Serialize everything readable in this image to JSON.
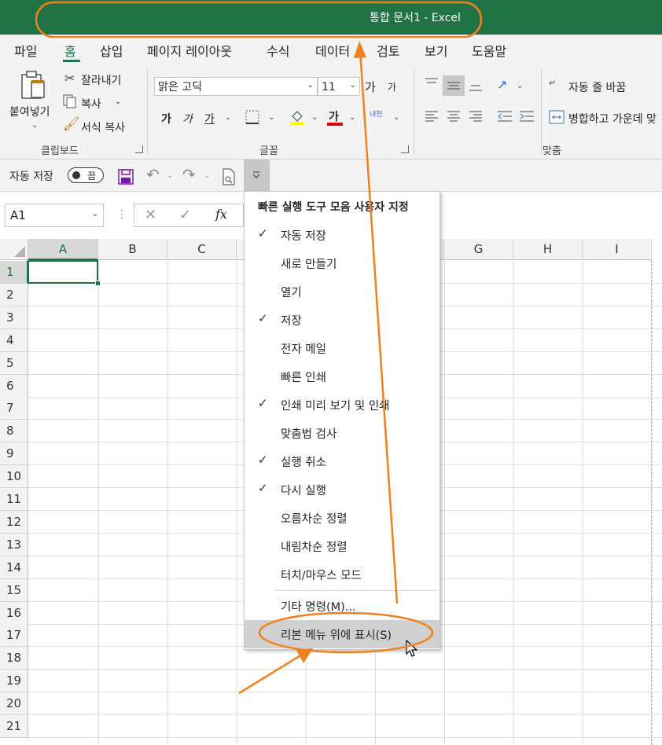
{
  "window": {
    "title": "통합 문서1  -  Excel"
  },
  "tabs": [
    "파일",
    "홈",
    "삽입",
    "페이지 레이아웃",
    "수식",
    "데이터",
    "검토",
    "보기",
    "도움말"
  ],
  "ribbon": {
    "clipboard": {
      "paste_label": "붙여넣기",
      "cut_label": "잘라내기",
      "copy_label": "복사",
      "format_painter_label": "서식 복사",
      "group_label": "클립보드"
    },
    "font": {
      "font_name": "맑은 고딕",
      "font_size": "11",
      "grow_label": "가",
      "shrink_label": "가",
      "bold_label": "가",
      "italic_label": "가",
      "underline_label": "가",
      "font_color_label": "가",
      "phonetic_label": "내천",
      "group_label": "글꼴"
    },
    "alignment": {
      "wrap_text_label": "자동 줄 바꿈",
      "merge_label": "병합하고 가운데 맞",
      "group_label": "맞춤"
    }
  },
  "qat": {
    "autosave_label": "자동 저장",
    "toggle_state": "끔"
  },
  "formula_bar": {
    "name_box": "A1",
    "fx_label": "fx"
  },
  "grid": {
    "columns": [
      "A",
      "B",
      "C",
      "G",
      "H",
      "I"
    ],
    "rows": [
      "1",
      "2",
      "3",
      "4",
      "5",
      "6",
      "7",
      "8",
      "9",
      "10",
      "11",
      "12",
      "13",
      "14",
      "15",
      "16",
      "17",
      "18",
      "19",
      "20",
      "21"
    ],
    "selected_cell": "A1"
  },
  "menu": {
    "title": "빠른 실행 도구 모음 사용자 지정",
    "items": [
      {
        "label": "자동 저장",
        "checked": true
      },
      {
        "label": "새로 만들기",
        "checked": false
      },
      {
        "label": "열기",
        "checked": false
      },
      {
        "label": "저장",
        "checked": true
      },
      {
        "label": "전자 메일",
        "checked": false
      },
      {
        "label": "빠른 인쇄",
        "checked": false
      },
      {
        "label": "인쇄 미리 보기 및 인쇄",
        "checked": true
      },
      {
        "label": "맞춤법 검사",
        "checked": false
      },
      {
        "label": "실행 취소",
        "checked": true
      },
      {
        "label": "다시 실행",
        "checked": true
      },
      {
        "label": "오름차순 정렬",
        "checked": false
      },
      {
        "label": "내림차순 정렬",
        "checked": false
      },
      {
        "label": "터치/마우스 모드",
        "checked": false
      }
    ],
    "more_commands": "기타 명령(M)...",
    "show_above_ribbon": "리본 메뉴 위에 표시(S)"
  },
  "colors": {
    "excel_green": "#217346",
    "annotation_orange": "#f0821e"
  }
}
